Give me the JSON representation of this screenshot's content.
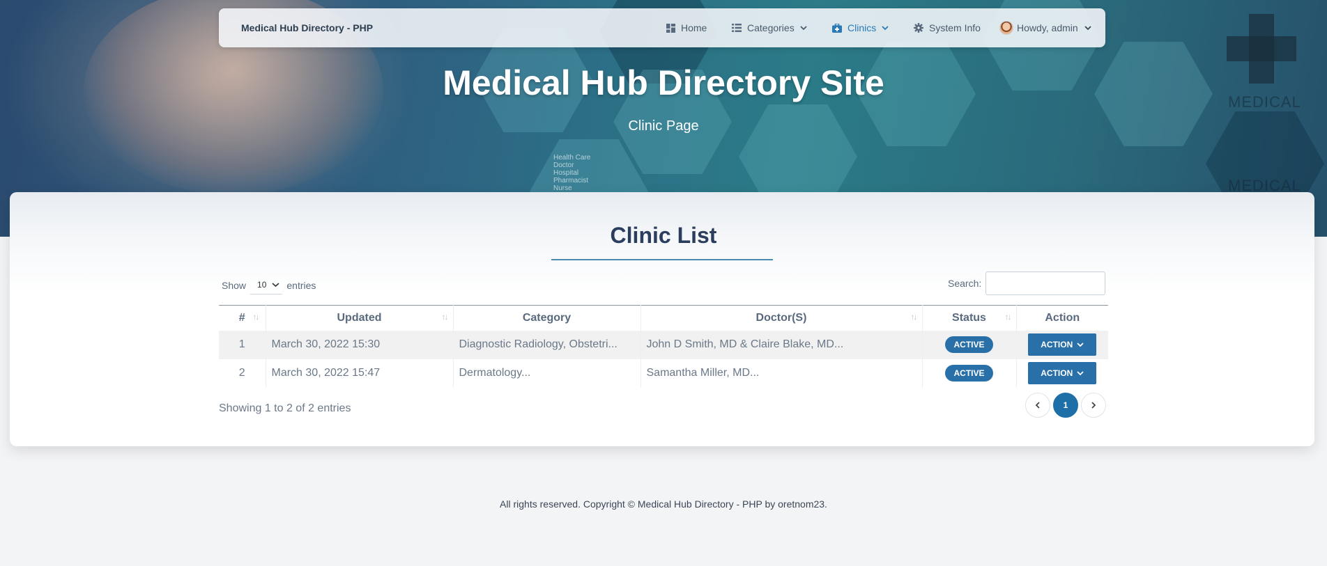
{
  "navbar": {
    "brand": "Medical Hub Directory - PHP",
    "items": [
      {
        "label": "Home",
        "icon": "dashboard-icon"
      },
      {
        "label": "Categories",
        "icon": "list-icon"
      },
      {
        "label": "Clinics",
        "icon": "briefcase-medical-icon"
      },
      {
        "label": "System Info",
        "icon": "gear-icon"
      }
    ],
    "user_label": "Howdy, admin"
  },
  "hero": {
    "title": "Medical Hub Directory Site",
    "subtitle": "Clinic Page",
    "background_text": [
      "Health Care",
      "Doctor",
      "Hospital",
      "Pharmacist",
      "Nurse"
    ],
    "background_labels": [
      "MEDICAL",
      "MEDICAL"
    ]
  },
  "main": {
    "title": "Clinic List",
    "show_label": "Show",
    "entries_value": "10",
    "entries_label": "entries",
    "search_label": "Search:",
    "search_value": "",
    "columns": [
      "#",
      "Updated",
      "Category",
      "Doctor(S)",
      "Status",
      "Action"
    ],
    "rows": [
      {
        "num": "1",
        "updated": "March 30, 2022 15:30",
        "category": "Diagnostic Radiology, Obstetri...",
        "doctors": "John D Smith, MD & Claire Blake, MD...",
        "status": "ACTIVE",
        "action": "ACTION"
      },
      {
        "num": "2",
        "updated": "March 30, 2022 15:47",
        "category": "Dermatology...",
        "doctors": "Samantha Miller, MD...",
        "status": "ACTIVE",
        "action": "ACTION"
      }
    ],
    "info": "Showing 1 to 2 of 2 entries",
    "current_page": "1"
  },
  "footer": {
    "text": "All rights reserved. Copyright © Medical Hub Directory - PHP by oretnom23."
  },
  "colors": {
    "accent": "#2a70a8",
    "title": "#2c3e5e",
    "active_nav": "#2a7ab8"
  }
}
